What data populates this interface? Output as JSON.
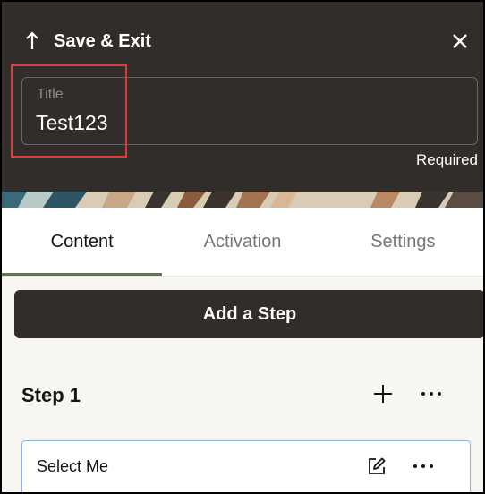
{
  "header": {
    "save_exit_label": "Save & Exit",
    "save_exit_icon": "arrow-up-icon",
    "close_icon": "close-icon",
    "background_color": "#312d2a"
  },
  "title_field": {
    "label": "Title",
    "value": "Test123",
    "required_text": "Required",
    "highlight_color": "#e03a3a"
  },
  "tabs": [
    {
      "label": "Content",
      "active": true
    },
    {
      "label": "Activation",
      "active": false
    },
    {
      "label": "Settings",
      "active": false
    }
  ],
  "add_step_label": "Add a Step",
  "step": {
    "title": "Step 1",
    "add_icon": "plus-icon",
    "more_icon": "more-horizontal-icon",
    "items": [
      {
        "label": "Select Me",
        "edit_icon": "edit-icon",
        "more_icon": "more-horizontal-icon"
      }
    ]
  },
  "colors": {
    "active_tab_underline": "#5a7a4a",
    "card_border": "#8fb4e0"
  }
}
